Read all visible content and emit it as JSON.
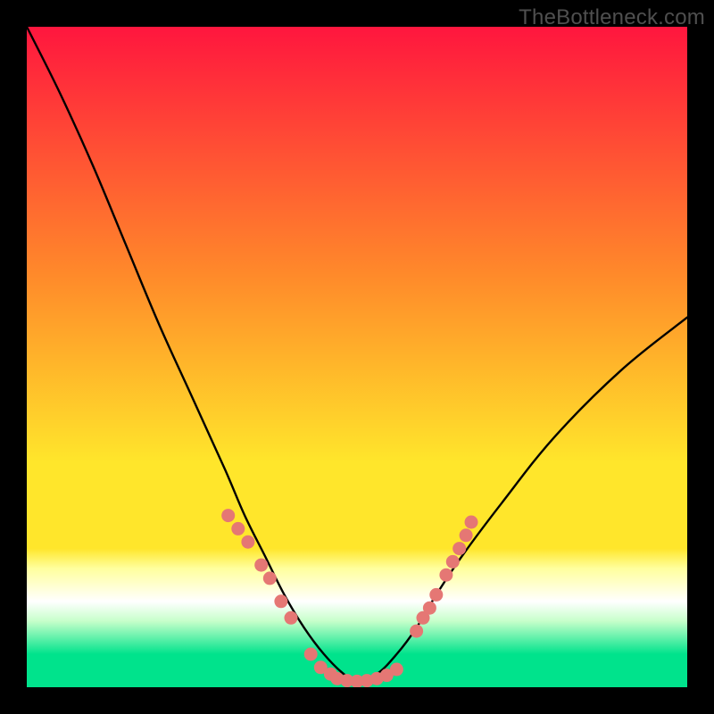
{
  "watermark": "TheBottleneck.com",
  "colors": {
    "black": "#000000",
    "curve": "#000000",
    "dot_fill": "#e57774",
    "dot_stroke": "#d85a56",
    "grad_top": "#ff163e",
    "grad_mid1": "#ff8b2a",
    "grad_mid2": "#ffe62b",
    "grad_yellow_pale": "#ffff9d",
    "grad_green_pale": "#c6ffca",
    "grad_green": "#00e38c"
  },
  "chart_data": {
    "type": "line",
    "title": "",
    "xlabel": "",
    "ylabel": "",
    "xlim": [
      0,
      100
    ],
    "ylim": [
      0,
      100
    ],
    "annotations": [
      "TheBottleneck.com"
    ],
    "series": [
      {
        "name": "bottleneck-curve",
        "x": [
          0,
          5,
          10,
          15,
          20,
          25,
          30,
          33,
          36,
          39,
          42,
          45,
          48,
          50,
          53,
          56,
          59,
          62,
          66,
          72,
          80,
          90,
          100
        ],
        "y": [
          100,
          90,
          79,
          67,
          55,
          44,
          33,
          26,
          20,
          14,
          9,
          5,
          2,
          1,
          2,
          5,
          9,
          14,
          20,
          28,
          38,
          48,
          56
        ]
      },
      {
        "name": "dots-left-branch",
        "x": [
          30.5,
          32.0,
          33.5,
          35.5,
          36.8,
          38.5,
          40.0,
          43.0,
          44.5,
          46.0
        ],
        "y": [
          26.0,
          24.0,
          22.0,
          18.5,
          16.5,
          13.0,
          10.5,
          5.0,
          3.0,
          2.0
        ]
      },
      {
        "name": "dots-bottom",
        "x": [
          47.0,
          48.5,
          50.0,
          51.5,
          53.0,
          54.5,
          56.0
        ],
        "y": [
          1.3,
          1.0,
          0.9,
          1.0,
          1.3,
          1.8,
          2.7
        ]
      },
      {
        "name": "dots-right-branch",
        "x": [
          59.0,
          60.0,
          61.0,
          62.0,
          63.5,
          64.5,
          65.5,
          66.5,
          67.3
        ],
        "y": [
          8.5,
          10.5,
          12.0,
          14.0,
          17.0,
          19.0,
          21.0,
          23.0,
          25.0
        ]
      }
    ],
    "background_gradient_stops": [
      {
        "pct": 0,
        "color": "#ff163e"
      },
      {
        "pct": 38,
        "color": "#ff8b2a"
      },
      {
        "pct": 66,
        "color": "#ffe62b"
      },
      {
        "pct": 79,
        "color": "#ffe62b"
      },
      {
        "pct": 82,
        "color": "#ffff9d"
      },
      {
        "pct": 87,
        "color": "#ffffff"
      },
      {
        "pct": 90,
        "color": "#c6ffca"
      },
      {
        "pct": 95,
        "color": "#00e38c"
      },
      {
        "pct": 100,
        "color": "#00e38c"
      }
    ]
  }
}
